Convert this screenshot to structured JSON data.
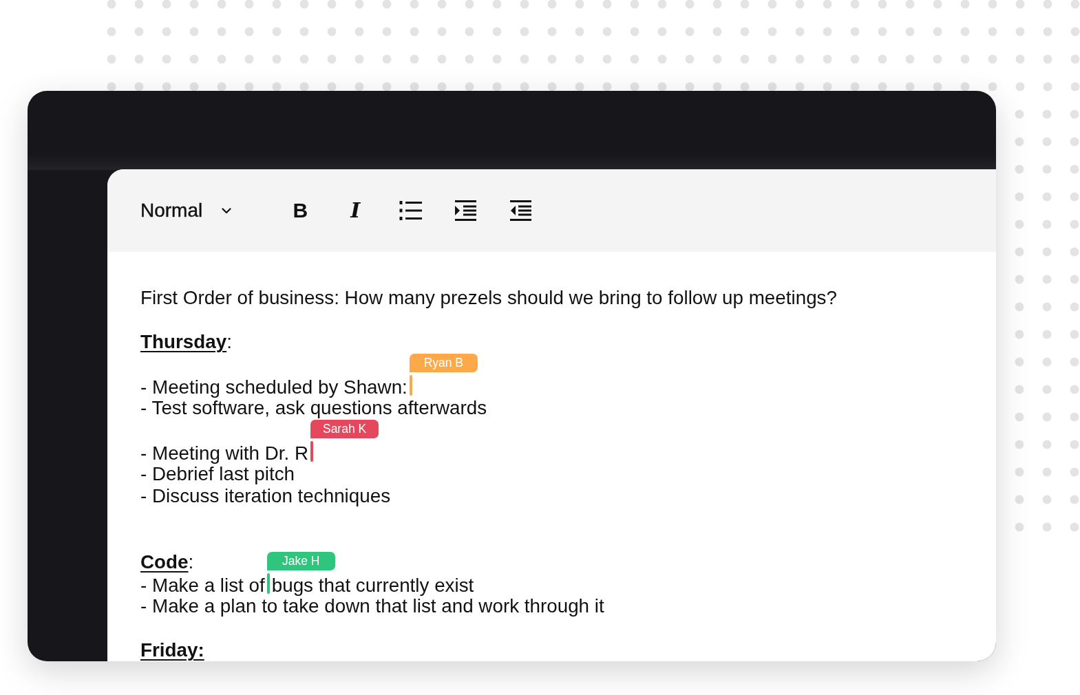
{
  "toolbar": {
    "style_select": {
      "value": "Normal"
    },
    "buttons": [
      {
        "kind": "bold",
        "label": "B"
      },
      {
        "kind": "italic",
        "label": "I"
      },
      {
        "kind": "list"
      },
      {
        "kind": "indent"
      },
      {
        "kind": "outdent"
      }
    ]
  },
  "document": {
    "lines": [
      {
        "kind": "paragraph",
        "text": "First Order of business: How many prezels should we bring to follow up meetings?"
      },
      {
        "kind": "blank"
      },
      {
        "kind": "heading",
        "text": "**Thursday**:"
      },
      {
        "kind": "blank"
      },
      {
        "kind": "paragraph",
        "text": "- Meeting scheduled by Shawn:",
        "cursor": {
          "user": "Ryan B",
          "color": "#fda94a"
        }
      },
      {
        "kind": "paragraph",
        "text": "- Test software, ask questions afterwards"
      },
      {
        "kind": "blank"
      },
      {
        "kind": "paragraph",
        "text": "- Meeting with Dr. R",
        "cursor": {
          "user": "Sarah K",
          "color": "#e5485c"
        }
      },
      {
        "kind": "paragraph",
        "text": "- Debrief last pitch"
      },
      {
        "kind": "paragraph",
        "text": "- Discuss iteration techniques"
      },
      {
        "kind": "blank"
      },
      {
        "kind": "blank"
      },
      {
        "kind": "heading",
        "text": "**Code**:"
      },
      {
        "kind": "paragraph",
        "text": "- Make a list of",
        "cursor": {
          "user": "Jake H",
          "color": "#2fc57c"
        },
        "text_after": "bugs that currently exist"
      },
      {
        "kind": "paragraph",
        "text": "- Make a plan to take down that list and work through it"
      },
      {
        "kind": "blank"
      },
      {
        "kind": "heading",
        "text": "**Friday:**"
      }
    ]
  }
}
